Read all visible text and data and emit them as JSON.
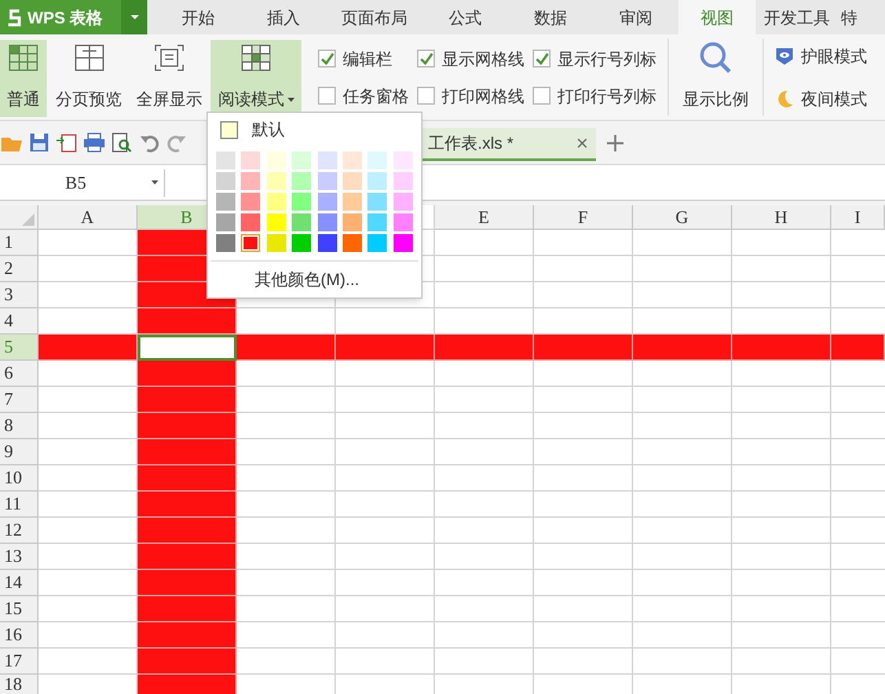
{
  "app_menu": {
    "label": "WPS 表格"
  },
  "tabs": [
    {
      "label": "开始",
      "selected": false
    },
    {
      "label": "插入",
      "selected": false
    },
    {
      "label": "页面布局",
      "selected": false
    },
    {
      "label": "公式",
      "selected": false
    },
    {
      "label": "数据",
      "selected": false
    },
    {
      "label": "审阅",
      "selected": false
    },
    {
      "label": "视图",
      "selected": true
    },
    {
      "label": "开发工具",
      "selected": false
    },
    {
      "label": "特",
      "selected": false
    }
  ],
  "view_buttons": [
    {
      "label": "普通",
      "kind": "normal",
      "selected": true
    },
    {
      "label": "分页预览",
      "kind": "pagebreak",
      "selected": false
    },
    {
      "label": "全屏显示",
      "kind": "fullscreen",
      "selected": false
    },
    {
      "label": "阅读模式",
      "kind": "reading",
      "selected": true
    }
  ],
  "checkboxes": [
    {
      "label": "编辑栏",
      "checked": true
    },
    {
      "label": "任务窗格",
      "checked": false
    },
    {
      "label": "显示网格线",
      "checked": true
    },
    {
      "label": "打印网格线",
      "checked": false
    },
    {
      "label": "显示行号列标",
      "checked": true
    },
    {
      "label": "打印行号列标",
      "checked": false
    }
  ],
  "zoom_button": {
    "label": "显示比例"
  },
  "modes": [
    {
      "label": "护眼模式",
      "kind": "eye"
    },
    {
      "label": "夜间模式",
      "kind": "night"
    }
  ],
  "document_tab": {
    "title": "工作表.xls *"
  },
  "name_box": {
    "value": "B5"
  },
  "columns": [
    {
      "kind": "header",
      "label": "A",
      "selected": false
    },
    {
      "kind": "header",
      "label": "B",
      "selected": true
    },
    {
      "kind": "covered"
    },
    {
      "kind": "covered"
    },
    {
      "kind": "header",
      "label": "E",
      "selected": false
    },
    {
      "kind": "header",
      "label": "F",
      "selected": false
    },
    {
      "kind": "header",
      "label": "G",
      "selected": false
    },
    {
      "kind": "header",
      "label": "H",
      "selected": false
    },
    {
      "kind": "header",
      "label": "I",
      "selected": false
    }
  ],
  "rows": [
    {
      "label": "1",
      "selected": false
    },
    {
      "label": "2",
      "selected": false
    },
    {
      "label": "3",
      "selected": false
    },
    {
      "label": "4",
      "selected": false
    },
    {
      "label": "5",
      "selected": true
    },
    {
      "label": "6",
      "selected": false
    },
    {
      "label": "7",
      "selected": false
    },
    {
      "label": "8",
      "selected": false
    },
    {
      "label": "9",
      "selected": false
    },
    {
      "label": "10",
      "selected": false
    },
    {
      "label": "11",
      "selected": false
    },
    {
      "label": "12",
      "selected": false
    },
    {
      "label": "13",
      "selected": false
    },
    {
      "label": "14",
      "selected": false
    },
    {
      "label": "15",
      "selected": false
    },
    {
      "label": "16",
      "selected": false
    },
    {
      "label": "17",
      "selected": false
    },
    {
      "label": "18",
      "selected": false
    }
  ],
  "color_menu": {
    "default_label": "默认",
    "more_label": "其他颜色(M)...",
    "swatches": [
      [
        {
          "color": "#e4e4e4",
          "selected": false
        },
        {
          "color": "#ffd9d9",
          "selected": false
        },
        {
          "color": "#ffffe0",
          "selected": false
        },
        {
          "color": "#d9ffd9",
          "selected": false
        },
        {
          "color": "#e0e4ff",
          "selected": false
        },
        {
          "color": "#ffe8d8",
          "selected": false
        },
        {
          "color": "#e0f8ff",
          "selected": false
        },
        {
          "color": "#ffe8ff",
          "selected": false
        }
      ],
      [
        {
          "color": "#d4d4d4",
          "selected": false
        },
        {
          "color": "#ffb5b5",
          "selected": false
        },
        {
          "color": "#ffffb0",
          "selected": false
        },
        {
          "color": "#b0ffb0",
          "selected": false
        },
        {
          "color": "#c8ccff",
          "selected": false
        },
        {
          "color": "#ffdcc0",
          "selected": false
        },
        {
          "color": "#c0f0ff",
          "selected": false
        },
        {
          "color": "#ffd0ff",
          "selected": false
        }
      ],
      [
        {
          "color": "#b5b5b5",
          "selected": false
        },
        {
          "color": "#ff9090",
          "selected": false
        },
        {
          "color": "#ffff80",
          "selected": false
        },
        {
          "color": "#80ff80",
          "selected": false
        },
        {
          "color": "#a8b0ff",
          "selected": false
        },
        {
          "color": "#ffcc99",
          "selected": false
        },
        {
          "color": "#80e0ff",
          "selected": false
        },
        {
          "color": "#ffb0ff",
          "selected": false
        }
      ],
      [
        {
          "color": "#a6a6a6",
          "selected": false
        },
        {
          "color": "#ff6363",
          "selected": false
        },
        {
          "color": "#ffff00",
          "selected": false
        },
        {
          "color": "#70e070",
          "selected": false
        },
        {
          "color": "#8890ff",
          "selected": false
        },
        {
          "color": "#ffb070",
          "selected": false
        },
        {
          "color": "#50d8ff",
          "selected": false
        },
        {
          "color": "#ff80ff",
          "selected": false
        }
      ],
      [
        {
          "color": "#808080",
          "selected": false
        },
        {
          "color": "#ff1010",
          "selected": true
        },
        {
          "color": "#e8e800",
          "selected": false
        },
        {
          "color": "#00d000",
          "selected": false
        },
        {
          "color": "#4040ff",
          "selected": false
        },
        {
          "color": "#ff6600",
          "selected": false
        },
        {
          "color": "#00ccff",
          "selected": false
        },
        {
          "color": "#ff00ff",
          "selected": false
        }
      ]
    ]
  }
}
